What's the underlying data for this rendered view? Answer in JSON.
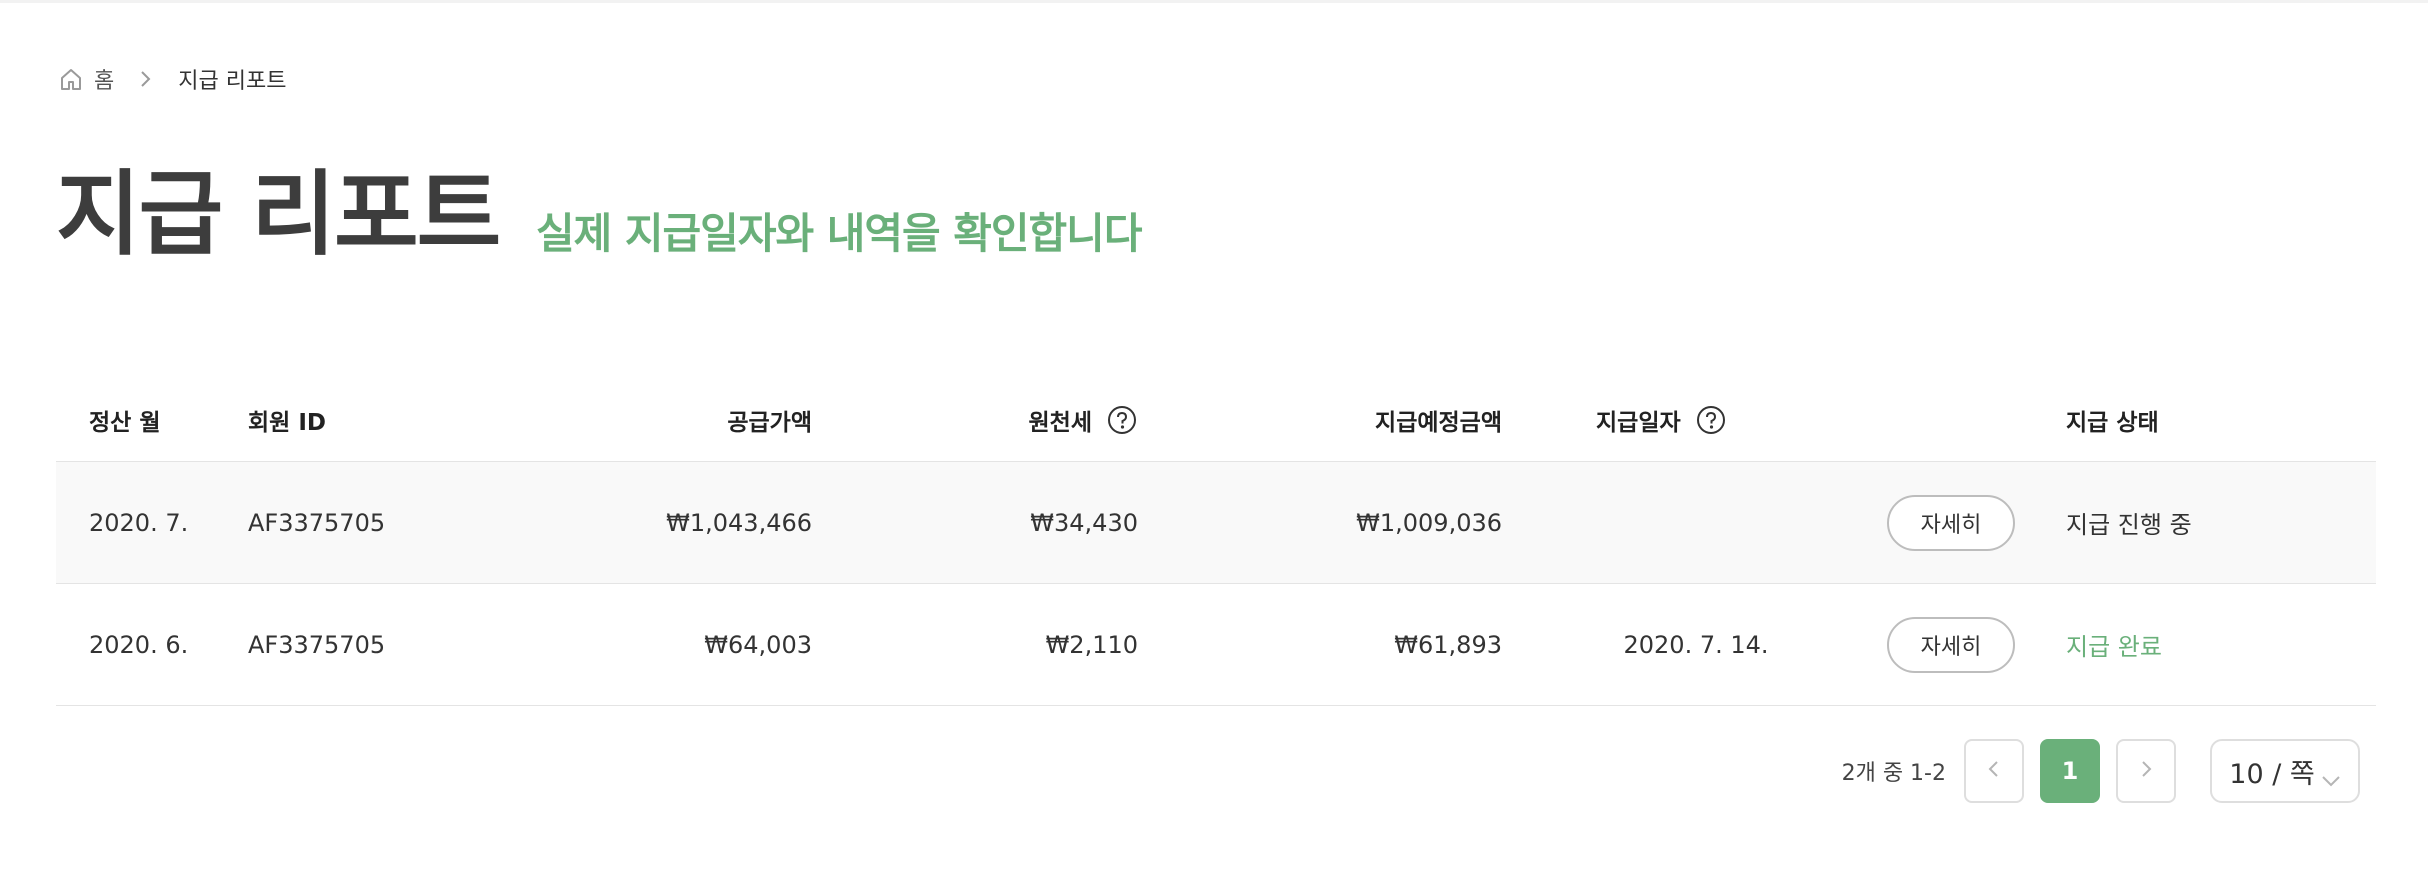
{
  "breadcrumb": {
    "home_label": "홈",
    "current_label": "지급 리포트"
  },
  "header": {
    "title": "지급 리포트",
    "subtitle": "실제 지급일자와 내역을 확인합니다"
  },
  "table": {
    "columns": {
      "month": "정산 월",
      "member_id": "회원 ID",
      "supply_amount": "공급가액",
      "withholding_tax": "원천세",
      "expected_amount": "지급예정금액",
      "pay_date": "지급일자",
      "status": "지급 상태"
    },
    "rows": [
      {
        "month": "2020. 7.",
        "member_id": "AF3375705",
        "supply_amount": "₩1,043,466",
        "withholding_tax": "₩34,430",
        "expected_amount": "₩1,009,036",
        "pay_date": "",
        "detail_label": "자세히",
        "status": "지급 진행 중"
      },
      {
        "month": "2020. 6.",
        "member_id": "AF3375705",
        "supply_amount": "₩64,003",
        "withholding_tax": "₩2,110",
        "expected_amount": "₩61,893",
        "pay_date": "2020. 7. 14.",
        "detail_label": "자세히",
        "status": "지급 완료"
      }
    ]
  },
  "pagination": {
    "summary": "2개 중 1-2",
    "current_page": "1",
    "page_size_label": "10 / 쪽"
  },
  "colors": {
    "accent": "#6ab07a",
    "title": "#3d3d3d",
    "row_shade": "#f9f9f9"
  },
  "icons": [
    "home-icon",
    "chevron-right-icon",
    "help-circle-icon",
    "chevron-left-icon",
    "chevron-down-icon"
  ]
}
